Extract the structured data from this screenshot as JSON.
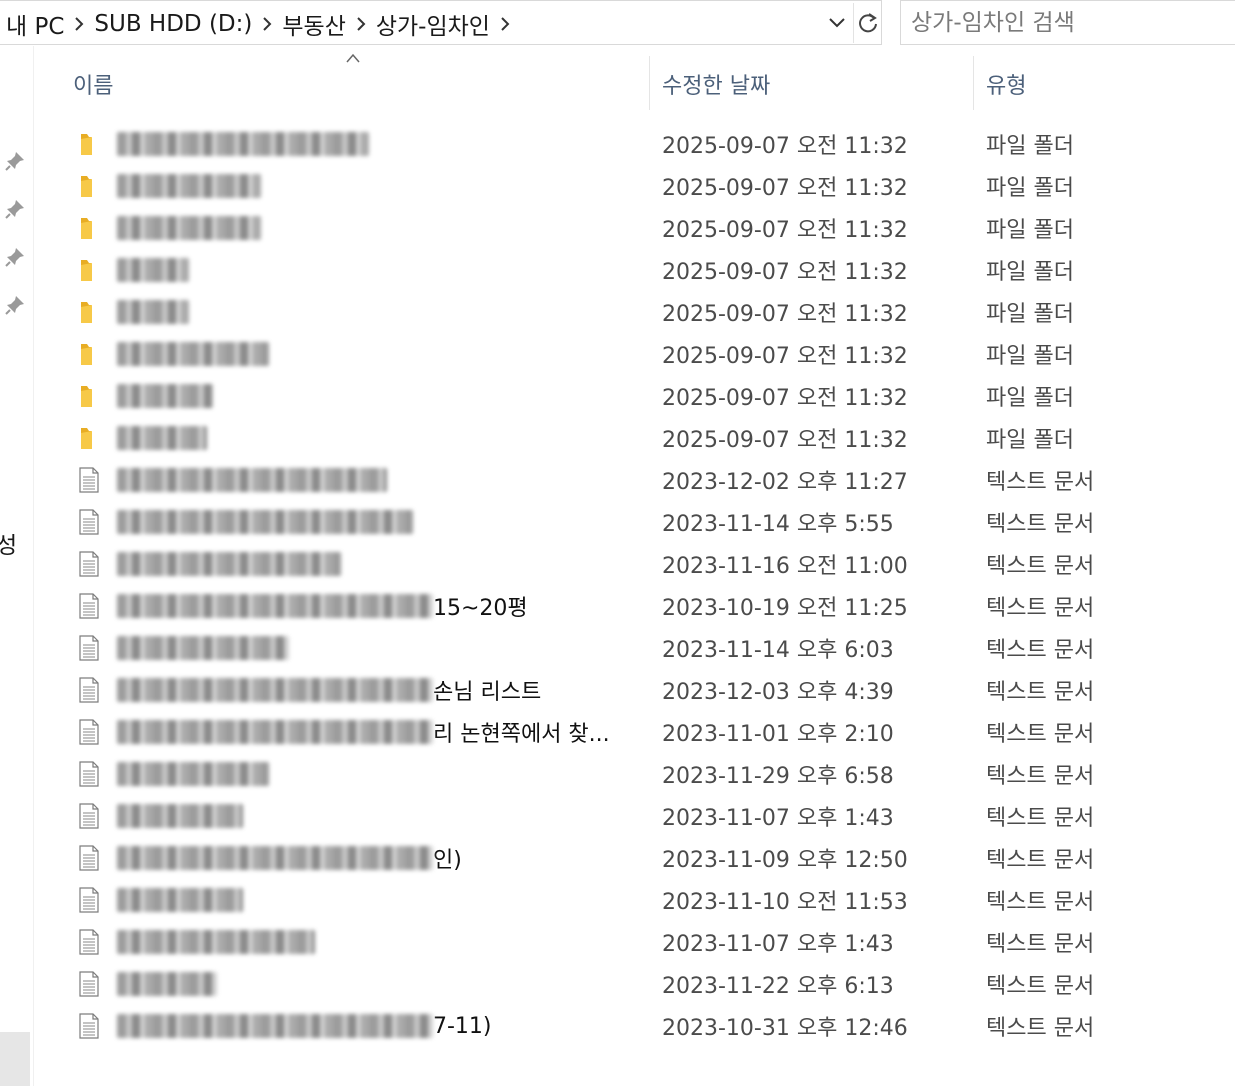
{
  "address_bar": {
    "crumbs": [
      "내 PC",
      "SUB HDD (D:)",
      "부동산",
      "상가-임차인"
    ]
  },
  "search": {
    "placeholder": "상가-임차인 검색"
  },
  "nav": {
    "fragment_text": "성"
  },
  "columns": {
    "name": "이름",
    "date": "수정한 날짜",
    "type": "유형"
  },
  "rows": [
    {
      "kind": "folder",
      "name_visible": "",
      "modified": "2025-09-07 오전 11:32",
      "type": "파일 폴더"
    },
    {
      "kind": "folder",
      "name_visible": "",
      "modified": "2025-09-07 오전 11:32",
      "type": "파일 폴더"
    },
    {
      "kind": "folder",
      "name_visible": "",
      "modified": "2025-09-07 오전 11:32",
      "type": "파일 폴더"
    },
    {
      "kind": "folder",
      "name_visible": "",
      "modified": "2025-09-07 오전 11:32",
      "type": "파일 폴더"
    },
    {
      "kind": "folder",
      "name_visible": "",
      "modified": "2025-09-07 오전 11:32",
      "type": "파일 폴더"
    },
    {
      "kind": "folder",
      "name_visible": "",
      "modified": "2025-09-07 오전 11:32",
      "type": "파일 폴더"
    },
    {
      "kind": "folder",
      "name_visible": "",
      "modified": "2025-09-07 오전 11:32",
      "type": "파일 폴더"
    },
    {
      "kind": "folder",
      "name_visible": "",
      "modified": "2025-09-07 오전 11:32",
      "type": "파일 폴더"
    },
    {
      "kind": "text",
      "name_visible": "",
      "modified": "2023-12-02 오후 11:27",
      "type": "텍스트 문서"
    },
    {
      "kind": "text",
      "name_visible": "",
      "modified": "2023-11-14 오후 5:55",
      "type": "텍스트 문서"
    },
    {
      "kind": "text",
      "name_visible": "",
      "modified": "2023-11-16 오전 11:00",
      "type": "텍스트 문서"
    },
    {
      "kind": "text",
      "name_visible": "15~20평",
      "modified": "2023-10-19 오전 11:25",
      "type": "텍스트 문서"
    },
    {
      "kind": "text",
      "name_visible": "",
      "modified": "2023-11-14 오후 6:03",
      "type": "텍스트 문서"
    },
    {
      "kind": "text",
      "name_visible": "손님 리스트",
      "modified": "2023-12-03 오후 4:39",
      "type": "텍스트 문서"
    },
    {
      "kind": "text",
      "name_visible": "리 논현쪽에서 찾...",
      "modified": "2023-11-01 오후 2:10",
      "type": "텍스트 문서"
    },
    {
      "kind": "text",
      "name_visible": "",
      "modified": "2023-11-29 오후 6:58",
      "type": "텍스트 문서"
    },
    {
      "kind": "text",
      "name_visible": "",
      "modified": "2023-11-07 오후 1:43",
      "type": "텍스트 문서"
    },
    {
      "kind": "text",
      "name_visible": "인)",
      "modified": "2023-11-09 오후 12:50",
      "type": "텍스트 문서"
    },
    {
      "kind": "text",
      "name_visible": "",
      "modified": "2023-11-10 오전 11:53",
      "type": "텍스트 문서"
    },
    {
      "kind": "text",
      "name_visible": "",
      "modified": "2023-11-07 오후 1:43",
      "type": "텍스트 문서"
    },
    {
      "kind": "text",
      "name_visible": "",
      "modified": "2023-11-22 오후 6:13",
      "type": "텍스트 문서"
    },
    {
      "kind": "text",
      "name_visible": "7-11)",
      "modified": "2023-10-31 오후 12:46",
      "type": "텍스트 문서"
    }
  ],
  "icons": {
    "folder": "folder-icon",
    "text": "text-document-icon",
    "pin": "pin-icon",
    "chevron": "chevron-right-icon",
    "dropdown": "chevron-down-icon",
    "refresh": "refresh-icon",
    "sort": "sort-ascending-icon"
  },
  "colors": {
    "header_text": "#4c607a",
    "folder_yellow": "#f4c63d",
    "meta_text": "#4b4b4b"
  }
}
